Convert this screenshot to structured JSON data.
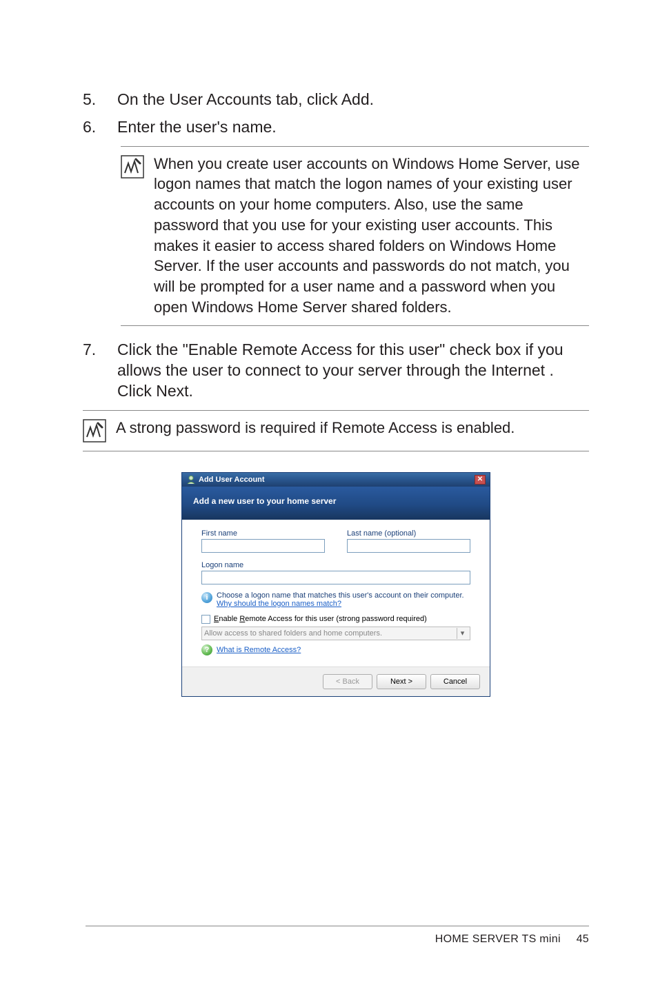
{
  "steps": {
    "s5": {
      "num": "5.",
      "text": "On the User Accounts tab, click Add."
    },
    "s6": {
      "num": "6.",
      "text": "Enter the user's name."
    },
    "s7": {
      "num": "7.",
      "text": "Click the \"Enable Remote Access for this user\" check box if you allows the user to connect to your server through the Internet . Click Next."
    }
  },
  "note1": "When you create user accounts on Windows Home Server, use logon names that match the logon names of your existing user accounts on your home computers. Also, use the same password that you use for your existing user accounts. This makes it easier to access shared folders on Windows Home Server. If the user accounts and passwords do not match, you will be prompted for a user name and a password when you open Windows Home Server shared folders.",
  "note2": "A strong password is required if Remote Access is enabled.",
  "dialog": {
    "title": "Add User Account",
    "banner": "Add a new user to your home server",
    "first_name_label": "First name",
    "last_name_label": "Last name (optional)",
    "logon_name_label": "Logon name",
    "info_text": "Choose a logon name that matches this user's account on their computer.",
    "info_link": "Why should the logon names match?",
    "enable_remote_label": "Enable Remote Access for this user (strong password required)",
    "dropdown_value": "Allow access to shared folders and home computers.",
    "help_link": "What is Remote Access?",
    "btn_back": "< Back",
    "btn_next": "Next >",
    "btn_cancel": "Cancel"
  },
  "footer": {
    "product": "HOME SERVER TS mini",
    "page": "45"
  }
}
